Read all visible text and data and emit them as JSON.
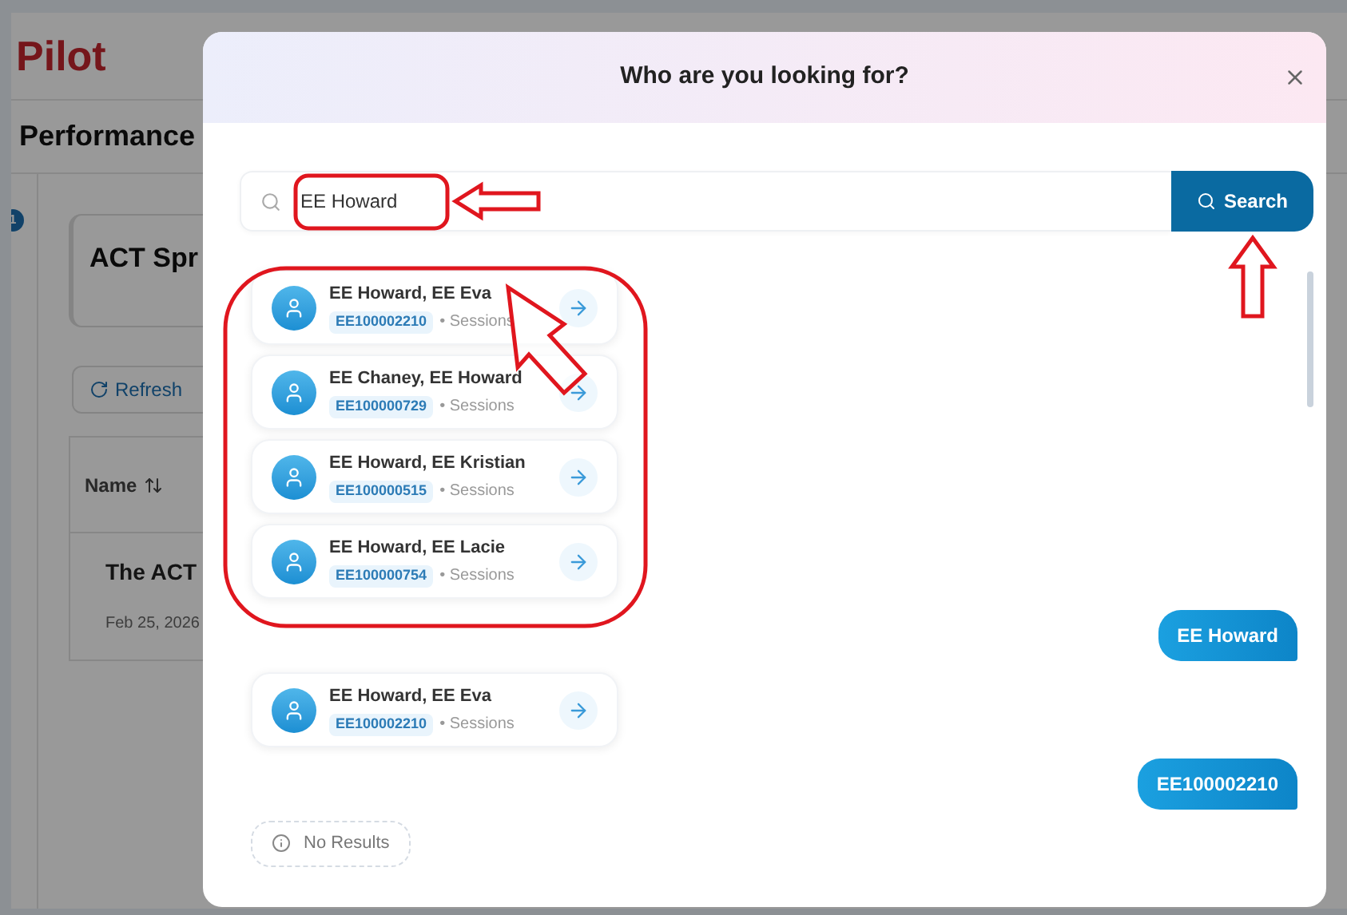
{
  "background": {
    "logo": "Pilot",
    "page_title": "Performance",
    "step_badge": "1",
    "card_title": "ACT Spr",
    "refresh_button": "Refresh",
    "column_header": "Name",
    "row_title": "The ACT",
    "row_date": "Feb 25, 2026"
  },
  "dialog": {
    "title": "Who are you looking for?",
    "search": {
      "value": "EE Howard",
      "button": "Search"
    },
    "messages": [
      {
        "kind": "results",
        "items": [
          {
            "name": "EE Howard, EE Eva",
            "id": "EE100002210",
            "meta": "• Sessions"
          },
          {
            "name": "EE Chaney, EE Howard",
            "id": "EE100000729",
            "meta": "• Sessions"
          },
          {
            "name": "EE Howard, EE Kristian",
            "id": "EE100000515",
            "meta": "• Sessions"
          },
          {
            "name": "EE Howard, EE Lacie",
            "id": "EE100000754",
            "meta": "• Sessions"
          }
        ]
      },
      {
        "kind": "user",
        "text": "EE Howard"
      },
      {
        "kind": "results",
        "items": [
          {
            "name": "EE Howard, EE Eva",
            "id": "EE100002210",
            "meta": "• Sessions"
          }
        ]
      },
      {
        "kind": "user",
        "text": "EE100002210"
      },
      {
        "kind": "notice",
        "text": "No Results"
      }
    ]
  }
}
